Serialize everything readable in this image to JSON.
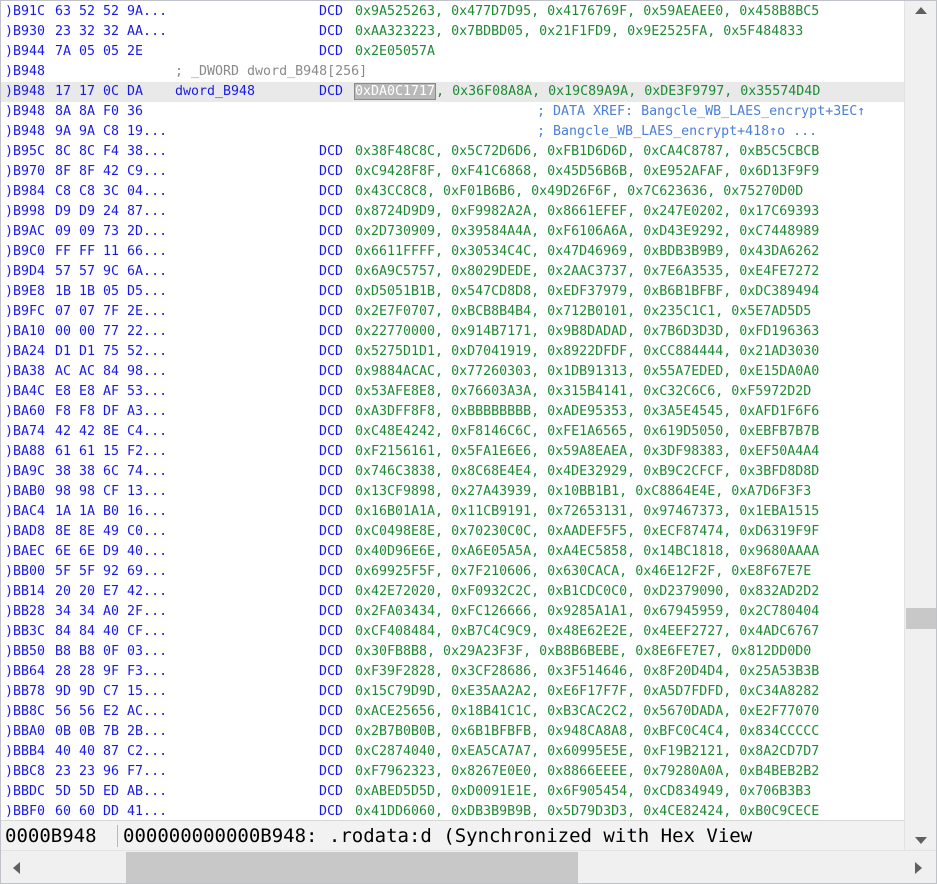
{
  "listing": {
    "rows": [
      {
        "addr": ")B91C",
        "bytes": "63 52 52 9A...",
        "mnem": "DCD",
        "ops": "0x9A525263, 0x477D7D95, 0x4176769F, 0x59AEAEE0, 0x458B8BC5"
      },
      {
        "addr": ")B930",
        "bytes": "23 32 32 AA...",
        "mnem": "DCD",
        "ops": "0xAA323223, 0x7BDBD05, 0x21F1FD9, 0x9E2525FA, 0x5F484833"
      },
      {
        "addr": ")B944",
        "bytes": "7A 05 05 2E",
        "mnem": "DCD",
        "ops": "0x2E05057A"
      },
      {
        "addr": ")B948",
        "comment": "; _DWORD dword_B948[256]"
      },
      {
        "addr": ")B948",
        "bytes": "17 17 0C DA",
        "name": "dword_B948",
        "mnem": "DCD",
        "sel": "0xDA0C1717",
        "ops_rest": ", 0x36F08A8A, 0x19C89A9A, 0xDE3F9797, 0x35574D4D",
        "current": true
      },
      {
        "addr": ")B948",
        "bytes": "8A 8A F0 36",
        "xref": "; DATA XREF: Bangcle_WB_LAES_encrypt+3EC↑"
      },
      {
        "addr": ")B948",
        "bytes": "9A 9A C8 19...",
        "xref": "; Bangcle_WB_LAES_encrypt+418↑o ..."
      },
      {
        "addr": ")B95C",
        "bytes": "8C 8C F4 38...",
        "mnem": "DCD",
        "ops": "0x38F48C8C, 0x5C72D6D6, 0xFB1D6D6D, 0xCA4C8787, 0xB5C5CBCB"
      },
      {
        "addr": ")B970",
        "bytes": "8F 8F 42 C9...",
        "mnem": "DCD",
        "ops": "0xC9428F8F, 0xF41C6868, 0x45D56B6B, 0xE952AFAF, 0x6D13F9F9"
      },
      {
        "addr": ")B984",
        "bytes": "C8 C8 3C 04...",
        "mnem": "DCD",
        "ops": "0x43CC8C8, 0xF01B6B6, 0x49D26F6F, 0x7C623636, 0x75270D0D"
      },
      {
        "addr": ")B998",
        "bytes": "D9 D9 24 87...",
        "mnem": "DCD",
        "ops": "0x8724D9D9, 0xF9982A2A, 0x8661EFEF, 0x247E0202, 0x17C69393"
      },
      {
        "addr": ")B9AC",
        "bytes": "09 09 73 2D...",
        "mnem": "DCD",
        "ops": "0x2D730909, 0x39584A4A, 0xF6106A6A, 0xD43E9292, 0xC7448989"
      },
      {
        "addr": ")B9C0",
        "bytes": "FF FF 11 66...",
        "mnem": "DCD",
        "ops": "0x6611FFFF, 0x30534C4C, 0x47D46969, 0xBDB3B9B9, 0x43DA6262"
      },
      {
        "addr": ")B9D4",
        "bytes": "57 57 9C 6A...",
        "mnem": "DCD",
        "ops": "0x6A9C5757, 0x8029DEDE, 0x2AAC3737, 0x7E6A3535, 0xE4FE7272"
      },
      {
        "addr": ")B9E8",
        "bytes": "1B 1B 05 D5...",
        "mnem": "DCD",
        "ops": "0xD5051B1B, 0x547CD8D8, 0xEDF37979, 0xB6B1BFBF, 0xDC389494"
      },
      {
        "addr": ")B9FC",
        "bytes": "07 07 7F 2E...",
        "mnem": "DCD",
        "ops": "0x2E7F0707, 0xBCB8B4B4, 0x712B0101, 0x235C1C1, 0x5E7AD5D5"
      },
      {
        "addr": ")BA10",
        "bytes": "00 00 77 22...",
        "mnem": "DCD",
        "ops": "0x22770000, 0x914B7171, 0x9B8DADAD, 0x7B6D3D3D, 0xFD196363"
      },
      {
        "addr": ")BA24",
        "bytes": "D1 D1 75 52...",
        "mnem": "DCD",
        "ops": "0x5275D1D1, 0xD7041919, 0x8922DFDF, 0xCC884444, 0x21AD3030"
      },
      {
        "addr": ")BA38",
        "bytes": "AC AC 84 98...",
        "mnem": "DCD",
        "ops": "0x9884ACAC, 0x77260303, 0x1DB91313, 0x55A7EDED, 0xE15DA0A0"
      },
      {
        "addr": ")BA4C",
        "bytes": "E8 E8 AF 53...",
        "mnem": "DCD",
        "ops": "0x53AFE8E8, 0x76603A3A, 0x315B4141, 0xC32C6C6, 0xF5972D2D"
      },
      {
        "addr": ")BA60",
        "bytes": "F8 F8 DF A3...",
        "mnem": "DCD",
        "ops": "0xA3DFF8F8, 0xBBBBBBBB, 0xADE95353, 0x3A5E4545, 0xAFD1F6F6"
      },
      {
        "addr": ")BA74",
        "bytes": "42 42 8E C4...",
        "mnem": "DCD",
        "ops": "0xC48E4242, 0xF8146C6C, 0xFE1A6565, 0x619D5050, 0xEBFB7B7B"
      },
      {
        "addr": ")BA88",
        "bytes": "61 61 15 F2...",
        "mnem": "DCD",
        "ops": "0xF2156161, 0x5FA1E6E6, 0x59A8EAEA, 0x3DF98383, 0xEF50A4A4"
      },
      {
        "addr": ")BA9C",
        "bytes": "38 38 6C 74...",
        "mnem": "DCD",
        "ops": "0x746C3838, 0x8C68E4E4, 0x4DE32929, 0xB9C2CFCF, 0x3BFD8D8D"
      },
      {
        "addr": ")BAB0",
        "bytes": "98 98 CF 13...",
        "mnem": "DCD",
        "ops": "0x13CF9898, 0x27A43939, 0x10BB1B1, 0xC8864E4E, 0xA7D6F3F3"
      },
      {
        "addr": ")BAC4",
        "bytes": "1A 1A B0 16...",
        "mnem": "DCD",
        "ops": "0x16B01A1A, 0x11CB9191, 0x72653131, 0x97467373, 0x1EBA1515"
      },
      {
        "addr": ")BAD8",
        "bytes": "8E 8E 49 C0...",
        "mnem": "DCD",
        "ops": "0xC0498E8E, 0x70230C0C, 0xAADEF5F5, 0xECF87474, 0xD6319F9F"
      },
      {
        "addr": ")BAEC",
        "bytes": "6E 6E D9 40...",
        "mnem": "DCD",
        "ops": "0x40D96E6E, 0xA6E05A5A, 0xA4EC5858, 0x14BC1818, 0x9680AAAA"
      },
      {
        "addr": ")BB00",
        "bytes": "5F 5F 92 69...",
        "mnem": "DCD",
        "ops": "0x69925F5F, 0x7F210606, 0x630CACA, 0x46E12F2F, 0xE8F67E7E"
      },
      {
        "addr": ")BB14",
        "bytes": "20 20 E7 42...",
        "mnem": "DCD",
        "ops": "0x42E72020, 0xF0932C2C, 0xB1CDC0C0, 0xD2379090, 0x832AD2D2"
      },
      {
        "addr": ")BB28",
        "bytes": "34 34 A0 2F...",
        "mnem": "DCD",
        "ops": "0x2FA03434, 0xFC126666, 0x9285A1A1, 0x67945959, 0x2C780404"
      },
      {
        "addr": ")BB3C",
        "bytes": "84 84 40 CF...",
        "mnem": "DCD",
        "ops": "0xCF408484, 0xB7C4C9C9, 0x48E62E2E, 0x4EEF2727, 0x4ADC6767"
      },
      {
        "addr": ")BB50",
        "bytes": "B8 B8 0F 03...",
        "mnem": "DCD",
        "ops": "0x30FB8B8, 0x29A23F3F, 0xB8B6BEBE, 0x8E6FE7E7, 0x812DD0D0"
      },
      {
        "addr": ")BB64",
        "bytes": "28 28 9F F3...",
        "mnem": "DCD",
        "ops": "0xF39F2828, 0x3CF28686, 0x3F514646, 0x8F20D4D4, 0x25A53B3B"
      },
      {
        "addr": ")BB78",
        "bytes": "9D 9D C7 15...",
        "mnem": "DCD",
        "ops": "0x15C79D9D, 0xE35AA2A2, 0xE6F17F7F, 0xA5D7FDFD, 0xC34A8282"
      },
      {
        "addr": ")BB8C",
        "bytes": "56 56 E2 AC...",
        "mnem": "DCD",
        "ops": "0xACE25656, 0x18B41C1C, 0xB3CAC2C2, 0x5670DADA, 0xE2F77070"
      },
      {
        "addr": ")BBA0",
        "bytes": "0B 0B 7B 2B...",
        "mnem": "DCD",
        "ops": "0x2B7B0B0B, 0x6B1BFBFB, 0x948CA8A8, 0xBFC0C4C4, 0x834CCCCC"
      },
      {
        "addr": ")BBB4",
        "bytes": "40 40 87 C2...",
        "mnem": "DCD",
        "ops": "0xC2874040, 0xEA5CA7A7, 0x60995E5E, 0xF19B2121, 0x8A2CD7D7"
      },
      {
        "addr": ")BBC8",
        "bytes": "23 23 96 F7...",
        "mnem": "DCD",
        "ops": "0xF7962323, 0x8267E0E0, 0x8866EEEE, 0x79280A0A, 0xB4BEB2B2"
      },
      {
        "addr": ")BBDC",
        "bytes": "5D 5D ED AB...",
        "mnem": "DCD",
        "ops": "0xABED5D5D, 0xD0091E1E, 0x6F905454, 0xCD834949, 0x706B3B3"
      },
      {
        "addr": ")BBF0",
        "bytes": "60 60 DD 41...",
        "mnem": "DCD",
        "ops": "0x41DD6060, 0xDB3B9B9B, 0x5D79D3D3, 0x4CE82424, 0xB0C9CECE"
      }
    ]
  },
  "status": {
    "position": "0000B948",
    "location": "000000000000B948: .rodata:d (Synchronized with Hex View"
  },
  "colors": {
    "address": "#1a1ae6",
    "operand": "#1f8a34",
    "comment": "#8a8a8a",
    "xref": "#4c7fd6",
    "current_line": "#e9e9e9"
  }
}
